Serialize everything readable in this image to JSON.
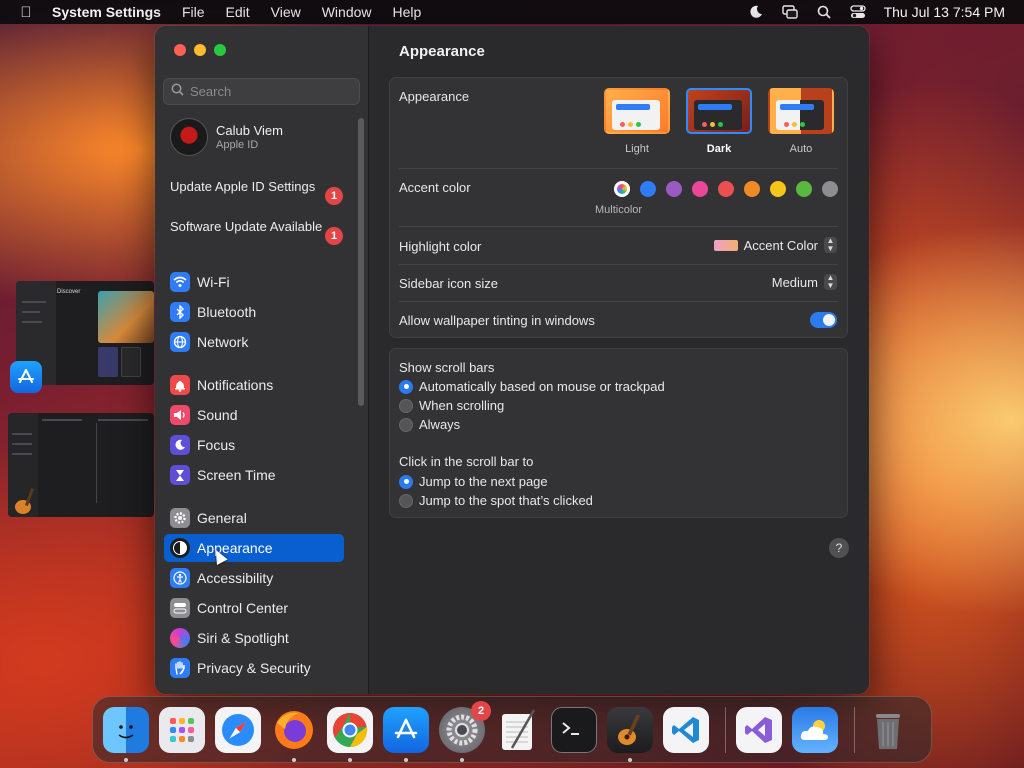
{
  "menubar": {
    "app_name": "System Settings",
    "menus": [
      "File",
      "Edit",
      "View",
      "Window",
      "Help"
    ],
    "clock": "Thu Jul 13  7:54 PM",
    "status_icons": [
      "moon-icon",
      "screen-mirroring-icon",
      "search-icon",
      "control-center-icon"
    ]
  },
  "sidebar": {
    "search_placeholder": "Search",
    "profile": {
      "name": "Calub Viem",
      "subtitle": "Apple ID"
    },
    "notices": [
      {
        "label": "Update Apple ID Settings",
        "badge": "1"
      },
      {
        "label": "Software Update Available",
        "badge": "1"
      }
    ],
    "items": [
      {
        "label": "Wi-Fi",
        "icon": "wifi-icon",
        "color": "#2f7cf6"
      },
      {
        "label": "Bluetooth",
        "icon": "bluetooth-icon",
        "color": "#2f7cf6"
      },
      {
        "label": "Network",
        "icon": "globe-icon",
        "color": "#2f7cf6"
      },
      {
        "label": "Notifications",
        "icon": "bell-icon",
        "color": "#ef4a4a"
      },
      {
        "label": "Sound",
        "icon": "speaker-icon",
        "color": "#ef4a6a"
      },
      {
        "label": "Focus",
        "icon": "moon-icon",
        "color": "#5e4fd8"
      },
      {
        "label": "Screen Time",
        "icon": "hourglass-icon",
        "color": "#5e4fd8"
      },
      {
        "label": "General",
        "icon": "gear-icon",
        "color": "#8e8e92"
      },
      {
        "label": "Appearance",
        "icon": "appearance-icon",
        "color": "#1c1c1e"
      },
      {
        "label": "Accessibility",
        "icon": "accessibility-icon",
        "color": "#2f7cf6"
      },
      {
        "label": "Control Center",
        "icon": "toggles-icon",
        "color": "#8e8e92"
      },
      {
        "label": "Siri & Spotlight",
        "icon": "siri-icon",
        "color": "#c33fd8"
      },
      {
        "label": "Privacy & Security",
        "icon": "hand-icon",
        "color": "#2f7cf6"
      }
    ],
    "selected": "Appearance"
  },
  "main": {
    "title": "Appearance",
    "appearance": {
      "label": "Appearance",
      "options": [
        "Light",
        "Dark",
        "Auto"
      ],
      "selected": "Dark"
    },
    "accent": {
      "label": "Accent color",
      "colors": [
        "multicolor",
        "#2f7cf6",
        "#9b59c4",
        "#e8479a",
        "#ec4f4f",
        "#f08a24",
        "#f5c518",
        "#5ab840",
        "#8e8e92"
      ],
      "selected_label": "Multicolor"
    },
    "highlight": {
      "label": "Highlight color",
      "value": "Accent Color"
    },
    "sidebar_icon_size": {
      "label": "Sidebar icon size",
      "value": "Medium"
    },
    "wallpaper_tinting": {
      "label": "Allow wallpaper tinting in windows",
      "enabled": true
    },
    "scroll_bars": {
      "label": "Show scroll bars",
      "options": [
        "Automatically based on mouse or trackpad",
        "When scrolling",
        "Always"
      ],
      "selected": 0
    },
    "click_scroll": {
      "label": "Click in the scroll bar to",
      "options": [
        "Jump to the next page",
        "Jump to the spot that’s clicked"
      ],
      "selected": 0
    },
    "help": "?"
  },
  "previews": {
    "top_title": "Discover"
  },
  "dock": {
    "items": [
      {
        "name": "Finder",
        "icon": "finder-icon",
        "running": true
      },
      {
        "name": "Launchpad",
        "icon": "launchpad-icon",
        "running": false
      },
      {
        "name": "Safari",
        "icon": "safari-icon",
        "running": false
      },
      {
        "name": "Firefox",
        "icon": "firefox-icon",
        "running": true
      },
      {
        "name": "Chrome",
        "icon": "chrome-icon",
        "running": true
      },
      {
        "name": "App Store",
        "icon": "app-store-icon",
        "running": true
      },
      {
        "name": "System Settings",
        "icon": "system-settings-icon",
        "running": true,
        "badge": "2"
      },
      {
        "name": "TextEdit",
        "icon": "textedit-icon",
        "running": false
      },
      {
        "name": "Terminal",
        "icon": "terminal-icon",
        "running": false
      },
      {
        "name": "GarageBand",
        "icon": "garageband-icon",
        "running": true
      },
      {
        "name": "VS Code",
        "icon": "vscode-icon",
        "running": false
      },
      {
        "name": "Visual Studio",
        "icon": "visual-studio-icon",
        "running": false
      },
      {
        "name": "Weather",
        "icon": "weather-icon",
        "running": false
      },
      {
        "name": "Trash",
        "icon": "trash-icon",
        "running": false
      }
    ]
  }
}
